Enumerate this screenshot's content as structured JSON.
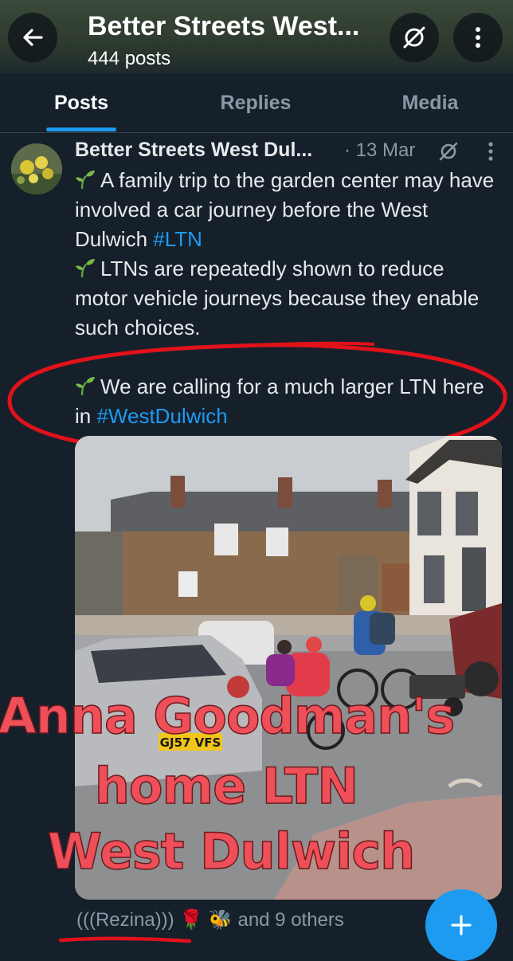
{
  "header": {
    "title": "Better Streets West...",
    "post_count": "444 posts",
    "back_icon": "arrow-left-icon",
    "sync_icon": "sync-off-icon",
    "more_icon": "more-vertical-icon"
  },
  "tabs": [
    {
      "label": "Posts",
      "active": true
    },
    {
      "label": "Replies",
      "active": false
    },
    {
      "label": "Media",
      "active": false
    }
  ],
  "post": {
    "author": "Better Streets West Dul...",
    "date": "· 13 Mar",
    "paragraphs": [
      {
        "text": "A family trip to the garden center may have involved a car journey before the West Dulwich ",
        "hashtag": "#LTN"
      },
      {
        "text": "LTNs are repeatedly shown to reduce motor vehicle journeys because they enable such choices.",
        "hashtag": ""
      },
      {
        "text": "We are calling for a much larger LTN here in ",
        "hashtag": "#WestDulwich"
      }
    ],
    "image_overlay": [
      "Anna Goodman's",
      "home LTN",
      "West Dulwich"
    ],
    "number_plate": "GJ57 VFS",
    "liked_by": "(((Rezina)))",
    "liked_by_suffix": "and 9 others"
  },
  "colors": {
    "background": "#15202b",
    "accent": "#1d9bf0",
    "muted": "#8b98a5",
    "annotation_red": "#e0121a"
  }
}
